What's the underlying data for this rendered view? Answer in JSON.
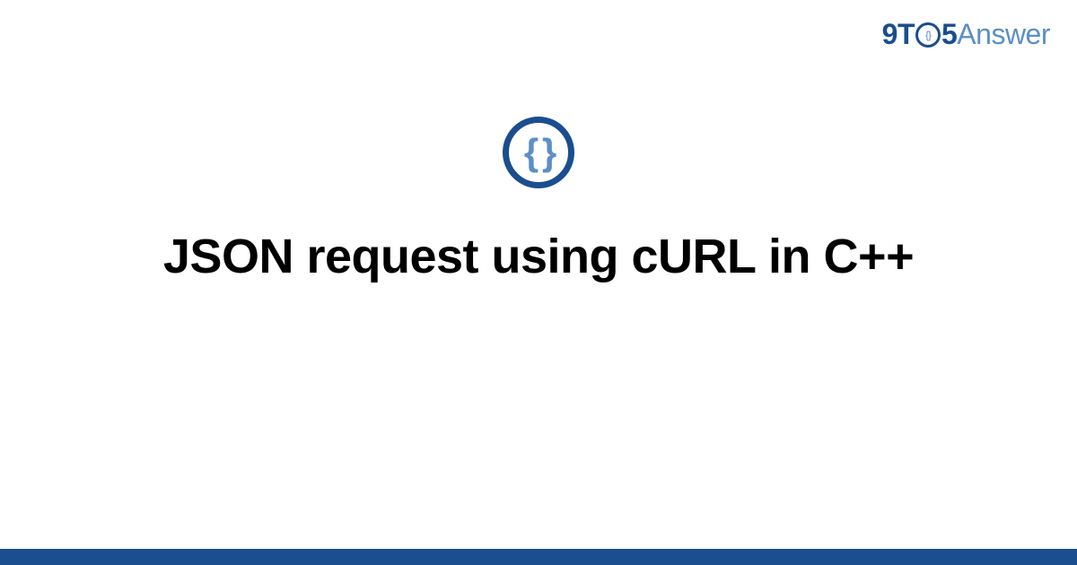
{
  "brand": {
    "part1": "9T",
    "clock_inner": "{}",
    "part2": "5",
    "part3": "Answer"
  },
  "icon": {
    "name": "json-braces-icon",
    "glyph": "{ }"
  },
  "title": "JSON request using cURL in C++",
  "colors": {
    "primary": "#1a4e8f",
    "secondary": "#5b8fc7",
    "text": "#000000",
    "background": "#ffffff"
  }
}
